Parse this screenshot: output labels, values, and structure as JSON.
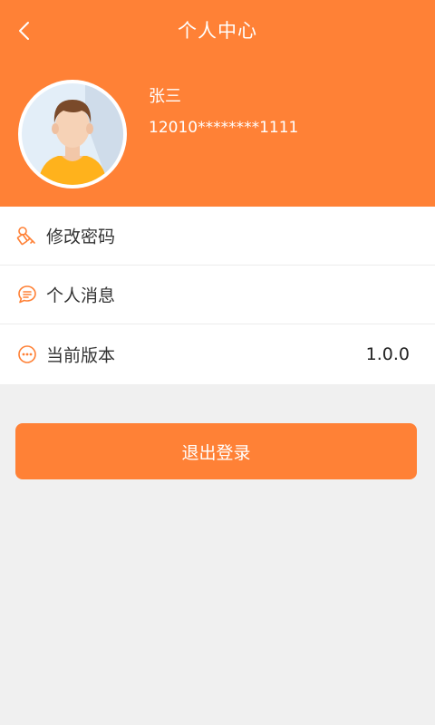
{
  "header": {
    "title": "个人中心",
    "back_icon": "chevron-left-icon",
    "background_color": "#ff8136"
  },
  "profile": {
    "name": "张三",
    "id": "12010********1111",
    "avatar_icon": "user-avatar-icon"
  },
  "menu": {
    "items": [
      {
        "label": "修改密码",
        "icon": "key-icon",
        "value": ""
      },
      {
        "label": "个人消息",
        "icon": "message-icon",
        "value": ""
      },
      {
        "label": "当前版本",
        "icon": "more-dots-icon",
        "value": "1.0.0"
      }
    ]
  },
  "logout": {
    "label": "退出登录",
    "color": "#ff8136"
  },
  "colors": {
    "accent": "#ff8136",
    "page_bg": "#f0f0f0",
    "icon": "#ff8136"
  }
}
